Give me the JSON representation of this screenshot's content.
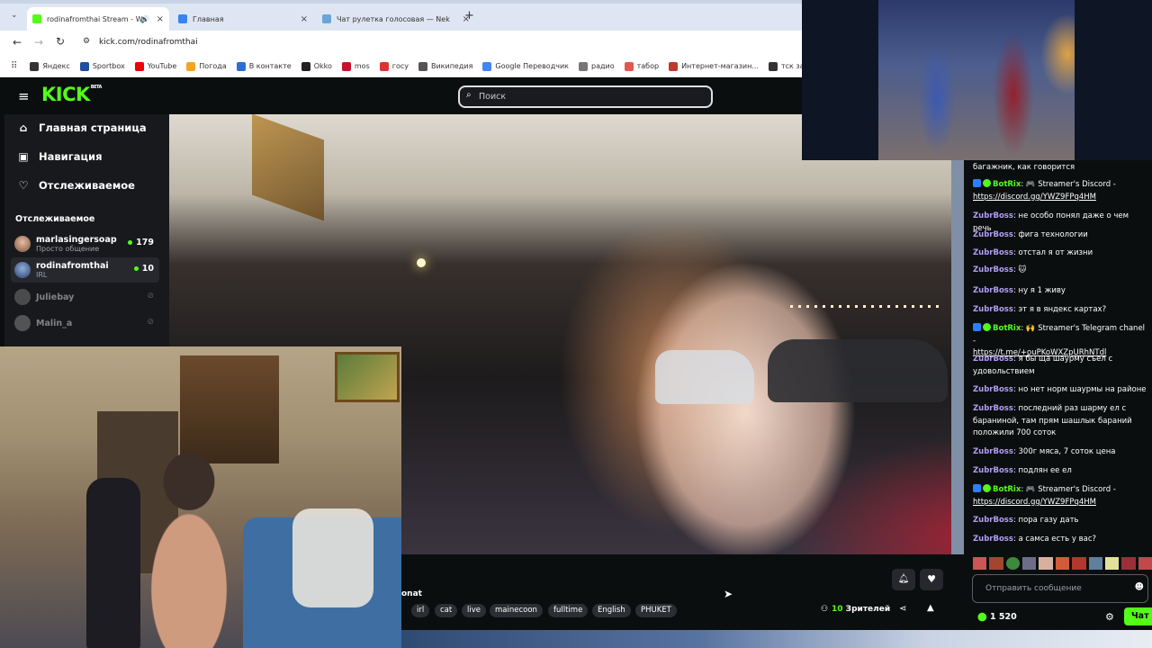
{
  "browser": {
    "tabs": [
      {
        "title": "rodinafromthai Stream - W",
        "active": true,
        "color": "#53fc18"
      },
      {
        "title": "Главная",
        "active": false,
        "color": "#3b82f6"
      },
      {
        "title": "Чат рулетка голосовая — Nek",
        "active": false,
        "color": "#6aa5d8"
      }
    ],
    "new_tab": "+",
    "url": "kick.com/rodinafromthai",
    "bookmarks": [
      {
        "label": "Яндекс",
        "color": "#333"
      },
      {
        "label": "Sportbox",
        "color": "#1e4fa0"
      },
      {
        "label": "YouTube",
        "color": "#e00"
      },
      {
        "label": "Погода",
        "color": "#f2a61e"
      },
      {
        "label": "В контакте",
        "color": "#2a6fd6"
      },
      {
        "label": "Okko",
        "color": "#222"
      },
      {
        "label": "mos",
        "color": "#c8102e"
      },
      {
        "label": "госу",
        "color": "#d33"
      },
      {
        "label": "Википедия",
        "color": "#555"
      },
      {
        "label": "Google Переводчик",
        "color": "#4285f4"
      },
      {
        "label": "радио",
        "color": "#777"
      },
      {
        "label": "табор",
        "color": "#e4574e"
      },
      {
        "label": "Интернет-магазин...",
        "color": "#c0392b"
      },
      {
        "label": "тск заря",
        "color": "#333"
      }
    ]
  },
  "kick": {
    "logo": "KICK",
    "logo_beta": "BETA",
    "search_placeholder": "Поиск",
    "nav": [
      {
        "label": "Главная страница",
        "icon": "home-icon"
      },
      {
        "label": "Навигация",
        "icon": "compass-icon"
      },
      {
        "label": "Отслеживаемое",
        "icon": "heart-icon"
      }
    ],
    "following_title": "Отслеживаемое",
    "following": [
      {
        "name": "marlasingersoap",
        "sub": "Просто общение",
        "count": "179"
      },
      {
        "name": "rodinafromthai",
        "sub": "IRL",
        "count": "10"
      },
      {
        "name": "Juliebay",
        "sub": "",
        "count": ""
      },
      {
        "name": "Malin_a",
        "sub": "",
        "count": ""
      }
    ],
    "stream": {
      "title_fragment": "onat",
      "tags": [
        "irl",
        "cat",
        "live",
        "mainecoon",
        "fulltime",
        "English",
        "PHUKET"
      ],
      "viewers_count": "10",
      "viewers_label": "Зрителей"
    },
    "chat": {
      "messages": [
        {
          "user": "",
          "text": "багажник, как говорится"
        },
        {
          "user": "BotRix",
          "bot": true,
          "text": "🎮 Streamer's Discord -",
          "link": "https://discord.gg/YWZ9FPq4HM"
        },
        {
          "user": "ZubrBoss",
          "text": "не особо понял даже о чем речь"
        },
        {
          "user": "ZubrBoss",
          "text": "фига технологии"
        },
        {
          "user": "ZubrBoss",
          "text": "отстал я от жизни"
        },
        {
          "user": "ZubrBoss",
          "text": "🐱"
        },
        {
          "user": "ZubrBoss",
          "text": "ну я 1 живу"
        },
        {
          "user": "ZubrBoss",
          "text": "эт я в яндекс картах?"
        },
        {
          "user": "BotRix",
          "bot": true,
          "text": "🙌 Streamer's Telegram chanel -",
          "link": "https://t.me/+ouPKoWXZpURhNTdl"
        },
        {
          "user": "ZubrBoss",
          "text": "я бы ща шаурму съел с удовольствием"
        },
        {
          "user": "ZubrBoss",
          "text": "но нет норм шаурмы на районе"
        },
        {
          "user": "ZubrBoss",
          "text": "последний раз шарму ел с бараниной, там прям шашлык бараний положили 700 соток"
        },
        {
          "user": "ZubrBoss",
          "text": "300г мяса, 7 соток цена"
        },
        {
          "user": "ZubrBoss",
          "text": "подлян ее ел"
        },
        {
          "user": "BotRix",
          "bot": true,
          "text": "🎮 Streamer's Discord -",
          "link": "https://discord.gg/YWZ9FPq4HM"
        },
        {
          "user": "ZubrBoss",
          "text": "пора газу дать"
        },
        {
          "user": "ZubrBoss",
          "text": "а самса есть у вас?"
        }
      ],
      "input_placeholder": "Отправить сообщение",
      "points": "1 520",
      "chat_button": "Чат"
    }
  }
}
